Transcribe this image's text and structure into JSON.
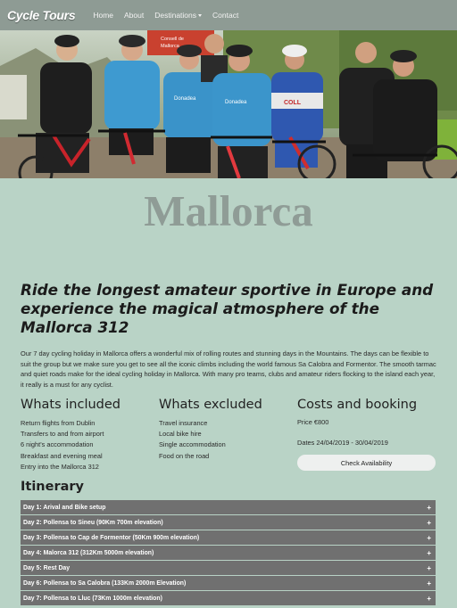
{
  "nav": {
    "brand": "Cycle Tours",
    "links": [
      "Home",
      "About",
      "Destinations",
      "Contact"
    ]
  },
  "hero": {
    "sign_text": [
      "Consell de",
      "Mallorca"
    ],
    "jersey_text": [
      "Donadea",
      "Donadea",
      "COLL"
    ]
  },
  "page": {
    "title": "Mallorca",
    "tagline": "Ride the longest amateur sportive in Europe and experience the magical atmosphere of the Mallorca 312",
    "intro": "Our 7 day cycling holiday in Mallorca offers a wonderful mix of rolling routes and stunning days in the Mountains. The days can be flexible to suit the group but we make sure you get to see all the iconic climbs including the world famous Sa Calobra and Formentor. The smooth tarmac and quiet roads make for the ideal cycling holiday in Mallorca. With many pro teams, clubs and amateur riders flocking to the island each year, it really is a must for any cyclist."
  },
  "included": {
    "title": "Whats included",
    "items": [
      "Return flights from Dublin",
      "Transfers to and from airport",
      "6 night's accommodation",
      "Breakfast and evening meal",
      "Entry into the Mallorca 312"
    ]
  },
  "excluded": {
    "title": "Whats excluded",
    "items": [
      "Travel insurance",
      "Local bike hire",
      "Single accommodation",
      "Food on the road"
    ]
  },
  "costs": {
    "title": "Costs and booking",
    "price": "Price €800",
    "dates": "Dates 24/04/2019 - 30/04/2019",
    "button": "Check Availability"
  },
  "itinerary": {
    "title": "Itinerary",
    "expand_symbol": "+",
    "days": [
      "Day 1: Arival and Bike setup",
      "Day 2: Pollensa to Sineu (90Km 700m elevation)",
      "Day 3: Pollensa to Cap de Formentor (50Km 900m elevation)",
      "Day 4: Malorca 312 (312Km 5000m elevation)",
      "Day 5: Rest Day",
      "Day 6: Pollensa to Sa Calobra (133Km 2000m Elevation)",
      "Day 7: Pollensa to Lluc (73Km 1000m elevation)"
    ]
  },
  "colors": {
    "background": "#b9d3c6",
    "navbar": "#8e9b94",
    "accordion": "#707070"
  }
}
